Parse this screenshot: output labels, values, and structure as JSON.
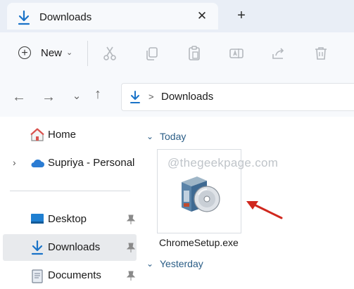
{
  "tab": {
    "title": "Downloads",
    "icon": "download-icon",
    "close_icon": "close-icon"
  },
  "new_tab_icon": "plus-icon",
  "toolbar": {
    "new_label": "New",
    "new_icon": "plus-circle-icon",
    "icons": [
      "cut-icon",
      "copy-icon",
      "paste-icon",
      "rename-icon",
      "share-icon",
      "delete-icon"
    ]
  },
  "nav": {
    "back_icon": "back-arrow-icon",
    "forward_icon": "forward-arrow-icon",
    "recent_icon": "chevron-down-icon",
    "up_icon": "up-arrow-icon"
  },
  "address": {
    "label": "Downloads",
    "separator": ">"
  },
  "sidebar": {
    "items": [
      {
        "label": "Home",
        "icon": "home-icon"
      },
      {
        "label": "Supriya - Personal",
        "icon": "cloud-icon"
      },
      {
        "label": "Desktop",
        "icon": "desktop-icon",
        "pinned": true
      },
      {
        "label": "Downloads",
        "icon": "download-icon",
        "pinned": true,
        "selected": true
      },
      {
        "label": "Documents",
        "icon": "documents-icon",
        "pinned": true
      }
    ]
  },
  "content": {
    "groups": [
      {
        "label": "Today"
      },
      {
        "label": "Yesterday"
      }
    ],
    "file": {
      "name": "ChromeSetup.exe",
      "icon": "installer-icon"
    },
    "watermark": "@thegeekpage.com"
  },
  "colors": {
    "accent": "#0f6cbd",
    "annotation_arrow": "#d0281e",
    "selected_bg": "#e8eaed"
  }
}
